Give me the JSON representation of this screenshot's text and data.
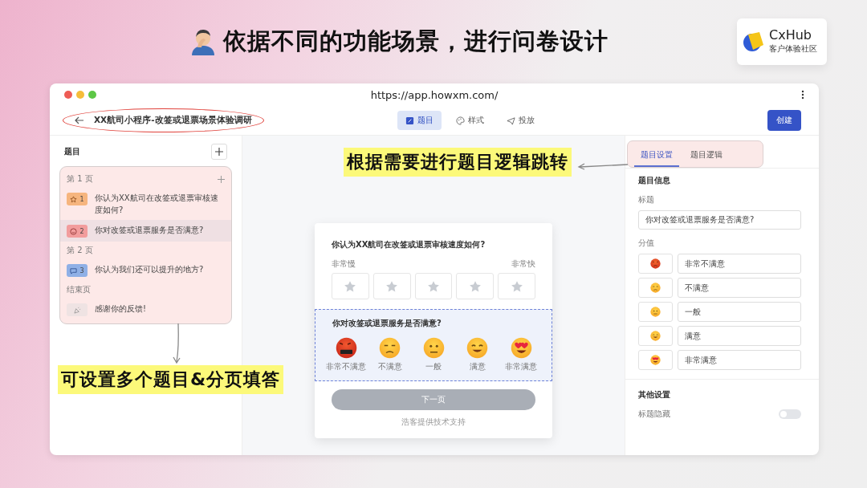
{
  "slide": {
    "title": "依据不同的功能场景，进行问卷设计",
    "logo": {
      "name": "CxHub",
      "tagline": "客户体验社区"
    }
  },
  "browser": {
    "url": "https://app.howxm.com/"
  },
  "header": {
    "survey_title": "XX航司小程序-改签或退票场景体验调研",
    "tabs": [
      {
        "kind": "questions",
        "label": "题目",
        "selected": true
      },
      {
        "kind": "style",
        "label": "样式",
        "selected": false
      },
      {
        "kind": "publish",
        "label": "投放",
        "selected": false
      }
    ],
    "create_button": "创建"
  },
  "questions_panel": {
    "title": "题目",
    "groups": [
      {
        "label": "第 1 页",
        "can_add": true,
        "items": [
          {
            "kind": "rating",
            "number": "1",
            "text": "你认为XX航司在改签或退票审核速度如何?",
            "selected": false
          },
          {
            "kind": "emoji",
            "number": "2",
            "text": "你对改签或退票服务是否满意?",
            "selected": true
          }
        ]
      },
      {
        "label": "第 2 页",
        "can_add": false,
        "items": [
          {
            "kind": "text",
            "number": "3",
            "text": "你认为我们还可以提升的地方?",
            "selected": false
          }
        ]
      },
      {
        "label": "结束页",
        "can_add": false,
        "items": [
          {
            "kind": "ending",
            "text": "感谢你的反馈!",
            "selected": false
          }
        ]
      }
    ]
  },
  "preview": {
    "rating_question": {
      "title": "你认为XX航司在改签或退票审核速度如何?",
      "low_label": "非常慢",
      "high_label": "非常快"
    },
    "emoji_question": {
      "title": "你对改签或退票服务是否满意?",
      "options": [
        {
          "kind": "furious",
          "label": "非常不满意"
        },
        {
          "kind": "annoyed",
          "label": "不满意"
        },
        {
          "kind": "neutral",
          "label": "一般"
        },
        {
          "kind": "happy",
          "label": "满意"
        },
        {
          "kind": "love",
          "label": "非常满意"
        }
      ]
    },
    "next_button": {
      "label": "下一页",
      "disabled": true
    },
    "footer": "浩客提供技术支持"
  },
  "settings": {
    "tabs": [
      {
        "label": "题目设置",
        "selected": true
      },
      {
        "label": "题目逻辑",
        "selected": false
      }
    ],
    "section_title": "题目信息",
    "title_label": "标题",
    "title_value": "你对改签或退票服务是否满意?",
    "score_label": "分值",
    "scores": [
      {
        "kind": "angry",
        "label": "非常不满意"
      },
      {
        "kind": "sad",
        "label": "不满意"
      },
      {
        "kind": "neutral",
        "label": "一般"
      },
      {
        "kind": "grin",
        "label": "满意"
      },
      {
        "kind": "love",
        "label": "非常满意"
      }
    ],
    "other_title": "其他设置",
    "toggle": {
      "label": "标题隐藏",
      "on": false
    }
  },
  "annotations": [
    {
      "kind": "logic",
      "text": "根据需要进行题目逻辑跳转"
    },
    {
      "kind": "pages",
      "text": "可设置多个题目&分页填答"
    }
  ]
}
